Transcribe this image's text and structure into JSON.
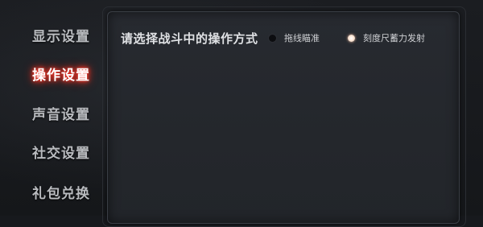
{
  "sidebar": {
    "items": [
      {
        "label": "显示设置",
        "active": false
      },
      {
        "label": "操作设置",
        "active": true
      },
      {
        "label": "声音设置",
        "active": false
      },
      {
        "label": "社交设置",
        "active": false
      },
      {
        "label": "礼包兑换",
        "active": false
      }
    ]
  },
  "main": {
    "question": "请选择战斗中的操作方式",
    "options": [
      {
        "label": "拖线瞄准",
        "checked": false
      },
      {
        "label": "刻度尺蓄力发射",
        "checked": true
      }
    ]
  },
  "colors": {
    "active_glow": "#e0281c",
    "text": "#b9bbbf",
    "panel": "#25282d"
  }
}
